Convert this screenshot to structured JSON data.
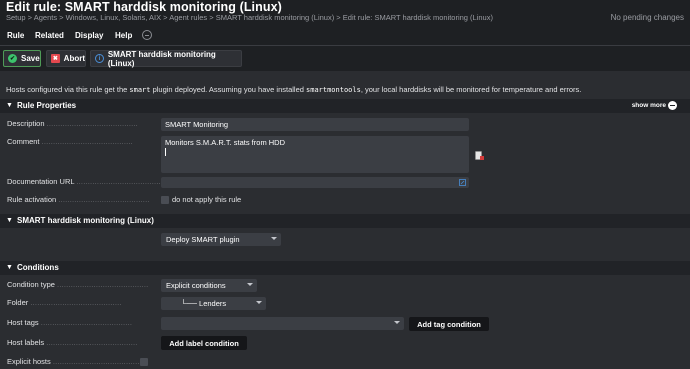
{
  "header": {
    "title": "Edit rule: SMART harddisk monitoring (Linux)",
    "breadcrumb": "Setup > Agents > Windows, Linux, Solaris, AIX > Agent rules > SMART harddisk monitoring (Linux) > Edit rule: SMART harddisk monitoring (Linux)",
    "pending": "No pending changes"
  },
  "menu": {
    "rule": "Rule",
    "related": "Related",
    "display": "Display",
    "help": "Help"
  },
  "toolbar": {
    "save": "Save",
    "abort": "Abort",
    "info": "SMART harddisk monitoring (Linux)"
  },
  "intro": {
    "part1": "Hosts configured via this rule get the ",
    "code1": "smart",
    "part2": " plugin deployed. Assuming you have installed ",
    "code2": "smartmontools",
    "part3": ", your local harddisks will be monitored for temperature and errors."
  },
  "rule_properties": {
    "title": "Rule Properties",
    "show_more": "show more",
    "description_label": "Description",
    "description_value": "SMART Monitoring",
    "comment_label": "Comment",
    "comment_value": "Monitors S.M.A.R.T. stats from HDD",
    "doc_url_label": "Documentation URL",
    "doc_url_value": "",
    "activation_label": "Rule activation",
    "activation_checkbox": "do not apply this rule"
  },
  "smart_section": {
    "title": "SMART harddisk monitoring (Linux)",
    "deploy_value": "Deploy SMART plugin"
  },
  "conditions": {
    "title": "Conditions",
    "condition_type_label": "Condition type",
    "condition_type_value": "Explicit conditions",
    "folder_label": "Folder",
    "folder_value": "└── Lenders",
    "host_tags_label": "Host tags",
    "host_tags_value": "",
    "add_tag_button": "Add tag condition",
    "host_labels_label": "Host labels",
    "add_label_button": "Add label condition",
    "explicit_hosts_label": "Explicit hosts"
  },
  "dots": "........................................",
  "colors": {
    "background": "#2b2d31",
    "header": "#1e2023",
    "field": "#3b3e44",
    "save_icon": "#3cc36c",
    "abort_icon": "#e4484f",
    "info_icon": "#4a8fd8"
  }
}
